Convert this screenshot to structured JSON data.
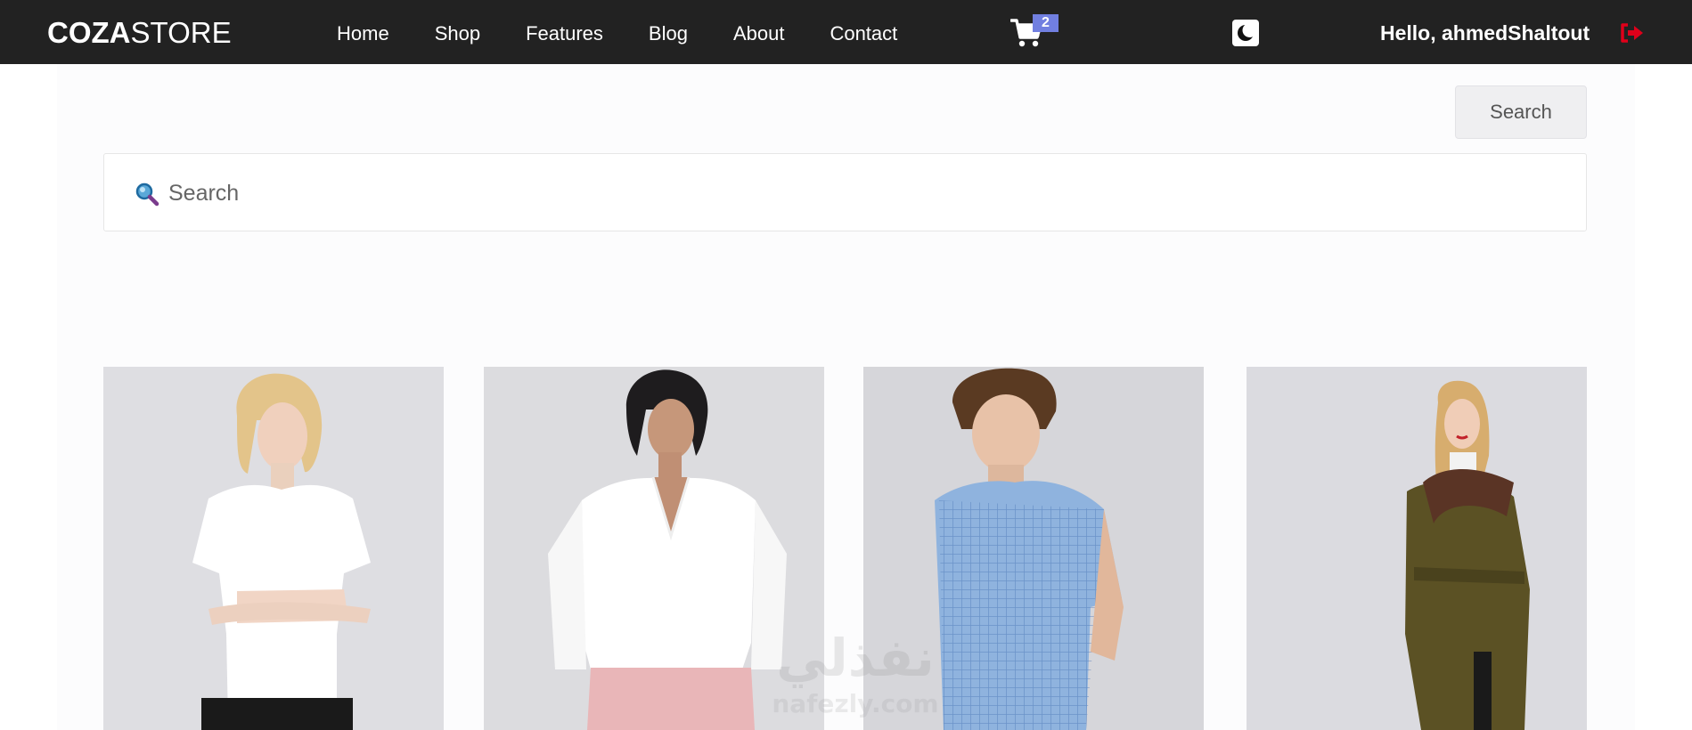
{
  "navbar": {
    "brand_bold": "COZA",
    "brand_light": "STORE",
    "links": [
      {
        "label": "Home"
      },
      {
        "label": "Shop"
      },
      {
        "label": "Features"
      },
      {
        "label": "Blog"
      },
      {
        "label": "About"
      },
      {
        "label": "Contact"
      }
    ],
    "cart_count": "2",
    "greeting": "Hello, ahmedShaltout",
    "icons": {
      "cart": "shopping-cart-icon",
      "theme": "moon-icon",
      "logout": "sign-out-icon"
    },
    "colors": {
      "background": "#222222",
      "badge": "#717fe0",
      "logout": "#e0001a"
    }
  },
  "search": {
    "button_label": "Search",
    "placeholder": "Search"
  },
  "products": [
    {
      "name": "woman-white-tshirt"
    },
    {
      "name": "woman-white-shirt"
    },
    {
      "name": "man-blue-check-shirt"
    },
    {
      "name": "woman-olive-coat"
    }
  ],
  "watermark": {
    "arabic": "نفذلي",
    "latin": "nafezly.com"
  }
}
